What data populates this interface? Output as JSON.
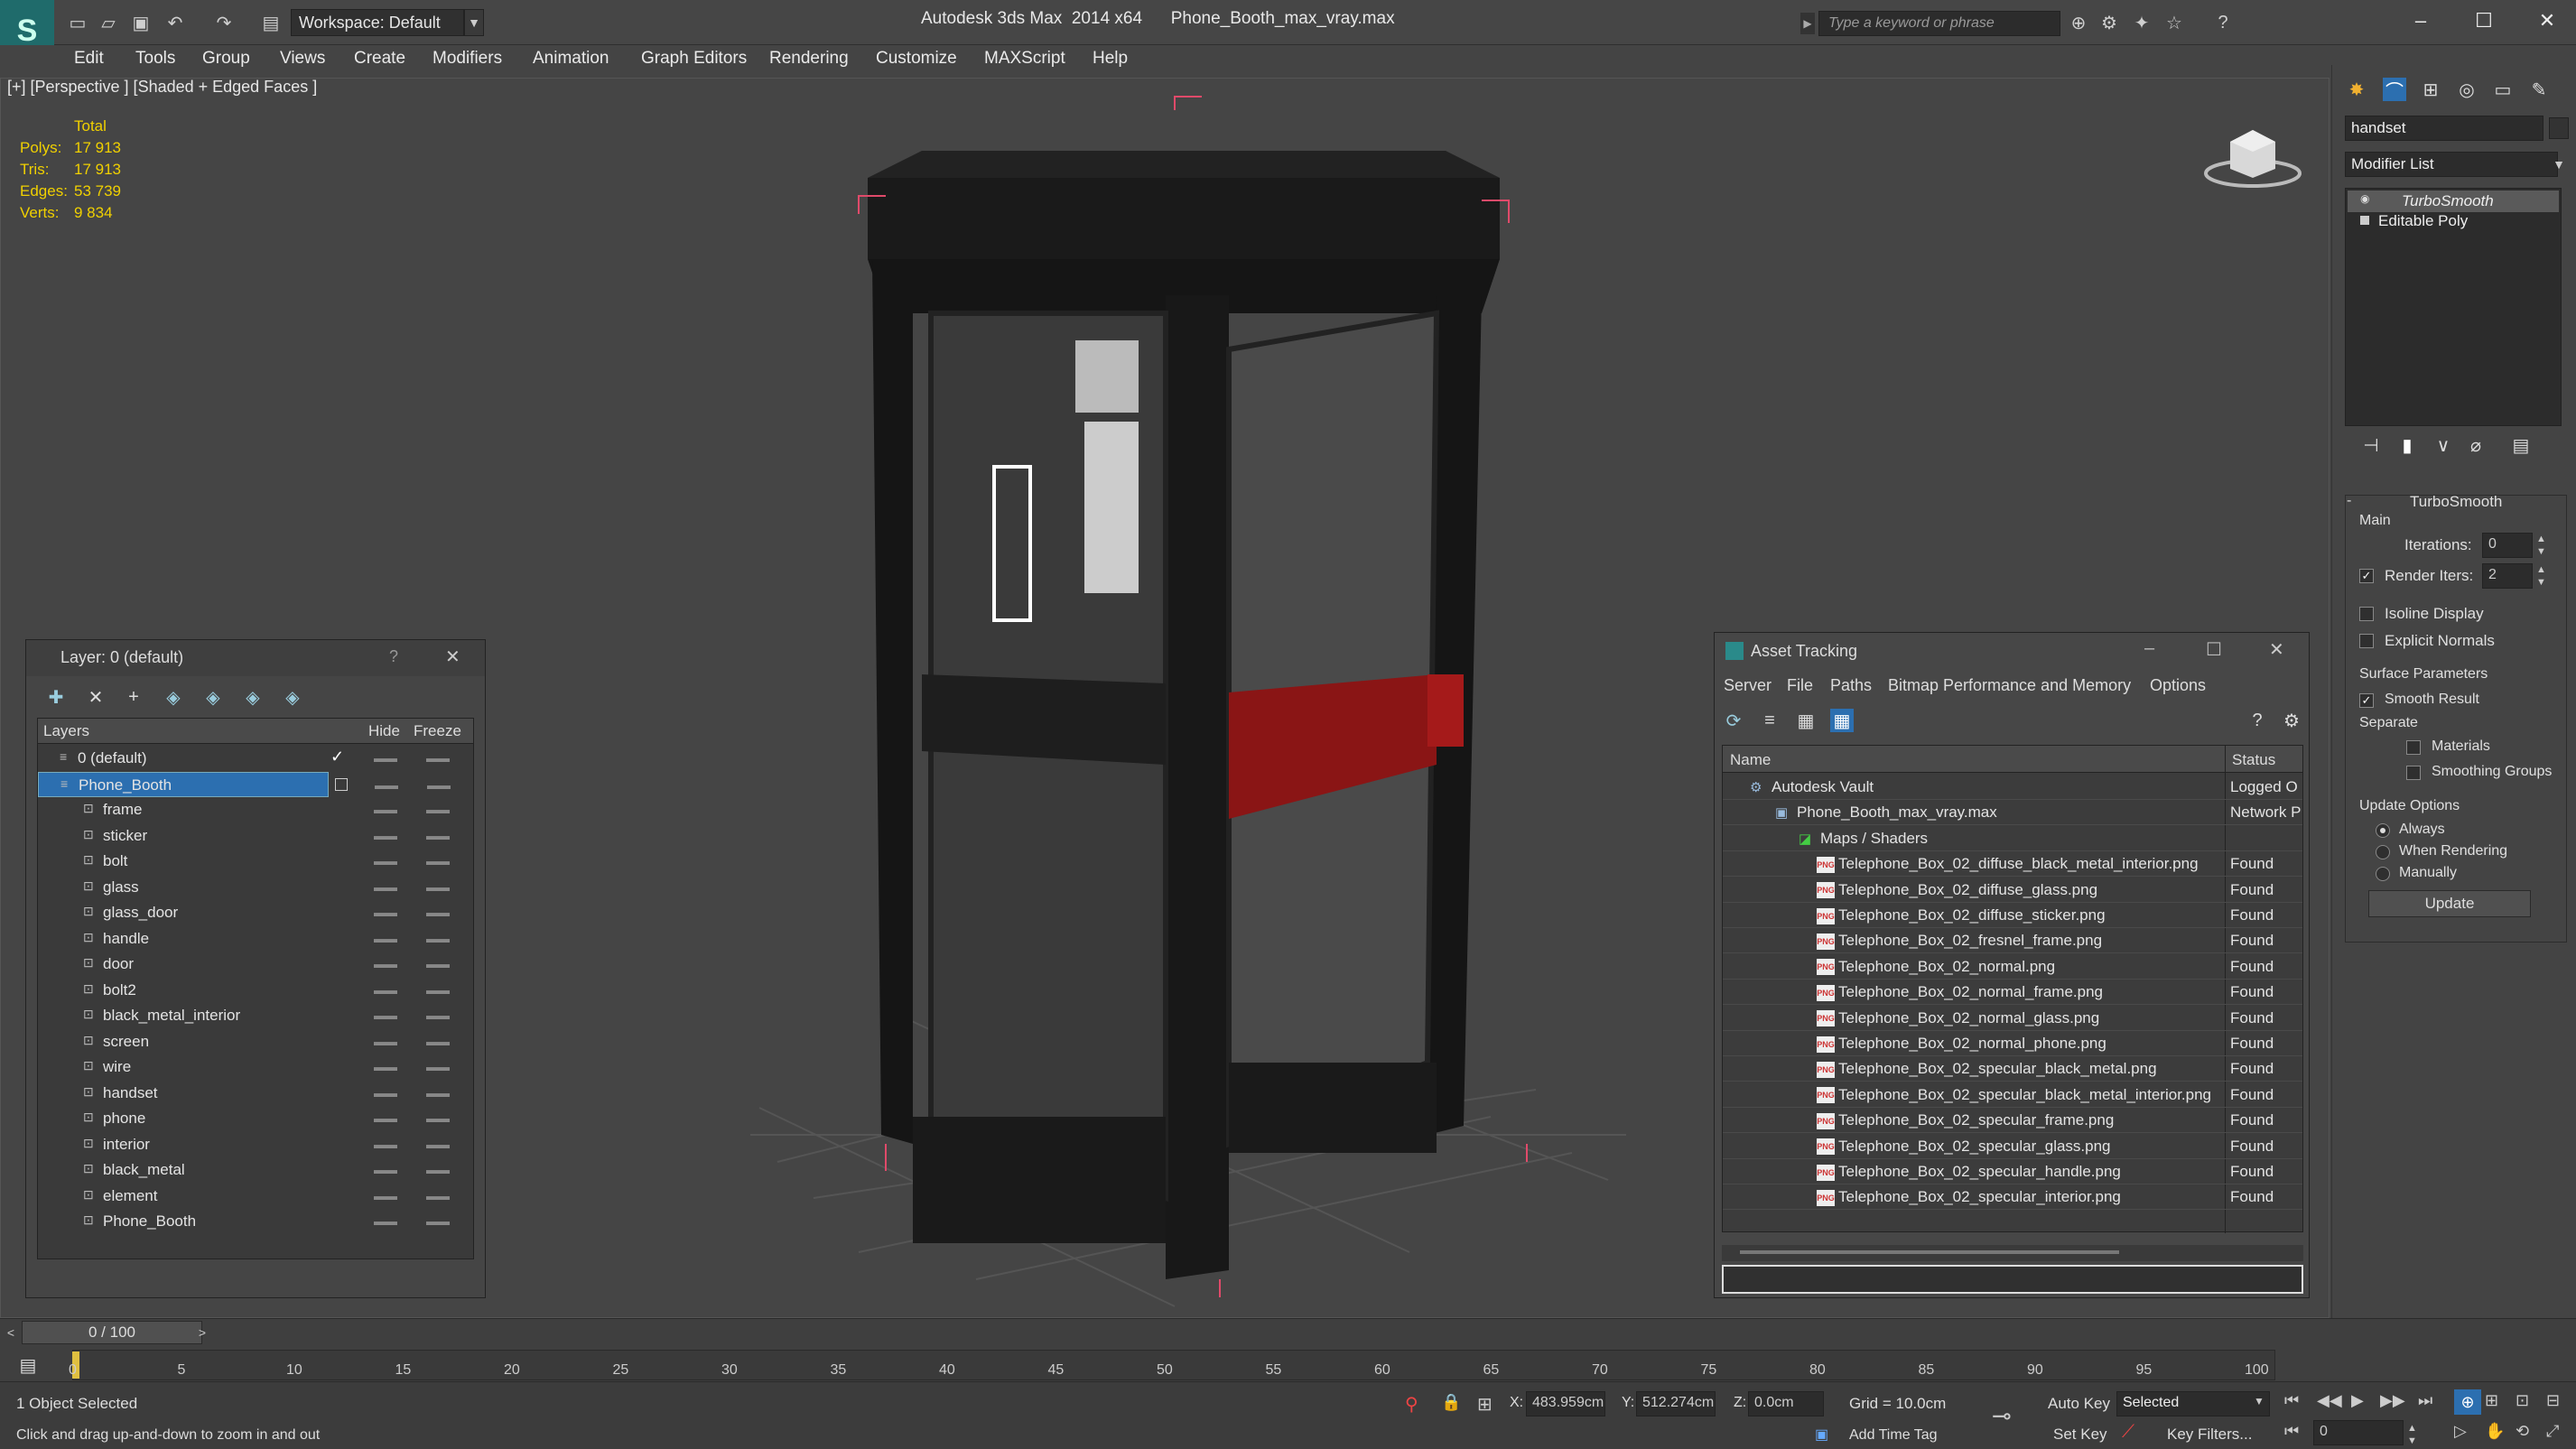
{
  "title": {
    "app": "Autodesk 3ds Max  2014 x64",
    "file": "Phone_Booth_max_vray.max"
  },
  "workspace": "Workspace: Default",
  "search_placeholder": "Type a keyword or phrase",
  "menus": [
    "Edit",
    "Tools",
    "Group",
    "Views",
    "Create",
    "Modifiers",
    "Animation",
    "Graph Editors",
    "Rendering",
    "Customize",
    "MAXScript",
    "Help"
  ],
  "viewport": {
    "label": "[+] [Perspective ] [Shaded + Edged Faces ]",
    "stats": {
      "header": "Total",
      "rows": [
        {
          "k": "Polys:",
          "v": "17 913"
        },
        {
          "k": "Tris:",
          "v": "17 913"
        },
        {
          "k": "Edges:",
          "v": "53 739"
        },
        {
          "k": "Verts:",
          "v": "9 834"
        }
      ]
    }
  },
  "layer_window": {
    "title": "Layer: 0 (default)",
    "help": "?",
    "col_layers": "Layers",
    "col_hide": "Hide",
    "col_freeze": "Freeze",
    "rows": [
      "0 (default)",
      "Phone_Booth",
      "frame",
      "sticker",
      "bolt",
      "glass",
      "glass_door",
      "handle",
      "door",
      "bolt2",
      "black_metal_interior",
      "screen",
      "wire",
      "handset",
      "phone",
      "interior",
      "black_metal",
      "element",
      "Phone_Booth"
    ]
  },
  "asset_window": {
    "title": "Asset Tracking",
    "menus": [
      "Server",
      "File",
      "Paths",
      "Bitmap Performance and Memory",
      "Options"
    ],
    "col_name": "Name",
    "col_status": "Status",
    "rows": [
      {
        "name": "Autodesk Vault",
        "status": "Logged O"
      },
      {
        "name": "Phone_Booth_max_vray.max",
        "status": "Network P"
      },
      {
        "name": "Maps / Shaders",
        "status": ""
      },
      {
        "name": "Telephone_Box_02_diffuse_black_metal_interior.png",
        "status": "Found"
      },
      {
        "name": "Telephone_Box_02_diffuse_glass.png",
        "status": "Found"
      },
      {
        "name": "Telephone_Box_02_diffuse_sticker.png",
        "status": "Found"
      },
      {
        "name": "Telephone_Box_02_fresnel_frame.png",
        "status": "Found"
      },
      {
        "name": "Telephone_Box_02_normal.png",
        "status": "Found"
      },
      {
        "name": "Telephone_Box_02_normal_frame.png",
        "status": "Found"
      },
      {
        "name": "Telephone_Box_02_normal_glass.png",
        "status": "Found"
      },
      {
        "name": "Telephone_Box_02_normal_phone.png",
        "status": "Found"
      },
      {
        "name": "Telephone_Box_02_specular_black_metal.png",
        "status": "Found"
      },
      {
        "name": "Telephone_Box_02_specular_black_metal_interior.png",
        "status": "Found"
      },
      {
        "name": "Telephone_Box_02_specular_frame.png",
        "status": "Found"
      },
      {
        "name": "Telephone_Box_02_specular_glass.png",
        "status": "Found"
      },
      {
        "name": "Telephone_Box_02_specular_handle.png",
        "status": "Found"
      },
      {
        "name": "Telephone_Box_02_specular_interior.png",
        "status": "Found"
      }
    ]
  },
  "command_panel": {
    "object_name": "handset",
    "modifier_list": "Modifier List",
    "stack": [
      "TurboSmooth",
      "Editable Poly"
    ],
    "rollout": "TurboSmooth",
    "main": "Main",
    "iterations_label": "Iterations:",
    "iterations": "0",
    "render_iters_label": "Render Iters:",
    "render_iters": "2",
    "isoline": "Isoline Display",
    "explicit": "Explicit Normals",
    "surface": "Surface Parameters",
    "smooth_result": "Smooth Result",
    "separate": "Separate",
    "materials": "Materials",
    "smoothing_groups": "Smoothing Groups",
    "update_options": "Update Options",
    "always": "Always",
    "when_rendering": "When Rendering",
    "manually": "Manually",
    "update": "Update"
  },
  "timeline": {
    "frame": "0 / 100",
    "ticks": [
      "0",
      "5",
      "10",
      "15",
      "20",
      "25",
      "30",
      "35",
      "40",
      "45",
      "50",
      "55",
      "60",
      "65",
      "70",
      "75",
      "80",
      "85",
      "90",
      "95",
      "100"
    ]
  },
  "status": {
    "selected": "1 Object Selected",
    "hint": "Click and drag up-and-down to zoom in and out",
    "x": "483.959cm",
    "y": "512.274cm",
    "z": "0.0cm",
    "grid": "Grid = 10.0cm",
    "add_time_tag": "Add Time Tag",
    "auto_key": "Auto Key",
    "set_key": "Set Key",
    "selected_dd": "Selected",
    "key_filters": "Key Filters...",
    "frame": "0"
  }
}
